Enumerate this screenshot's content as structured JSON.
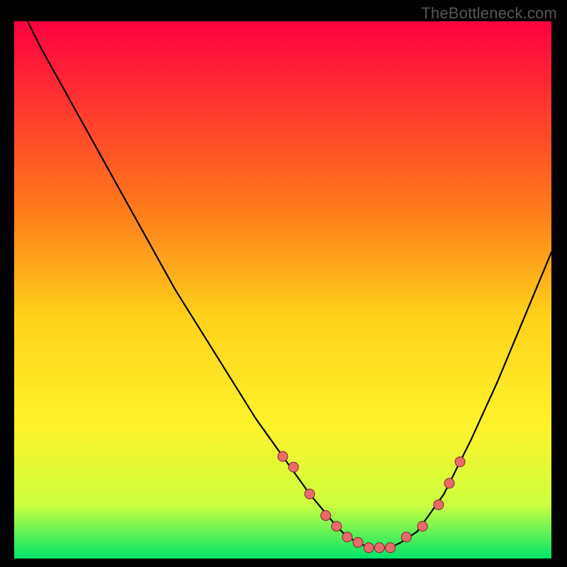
{
  "watermark": "TheBottleneck.com",
  "colors": {
    "gradient": [
      "#ff0040",
      "#ff7a1a",
      "#ffd21a",
      "#fff22a",
      "#ccff3e",
      "#00e56a"
    ],
    "curve_stroke": "#000000",
    "dot_fill": "#ea6a6a",
    "dot_stroke": "#7a2430"
  },
  "chart_data": {
    "type": "line",
    "title": "",
    "xlabel": "",
    "ylabel": "",
    "xlim": [
      0,
      100
    ],
    "ylim": [
      0,
      100
    ],
    "grid": false,
    "legend": false,
    "series": [
      {
        "name": "bottleneck-curve",
        "x": [
          0,
          5,
          10,
          15,
          20,
          25,
          30,
          35,
          40,
          45,
          50,
          55,
          60,
          62,
          64,
          66,
          68,
          70,
          72,
          75,
          80,
          85,
          90,
          95,
          100
        ],
        "values": [
          105,
          95,
          86,
          77,
          68,
          59,
          50,
          42,
          34,
          26,
          19,
          12,
          6,
          4,
          3,
          2,
          2,
          2,
          3,
          5,
          12,
          22,
          33,
          45,
          57
        ]
      }
    ],
    "annotations": {
      "salmon_dots": {
        "x": [
          50,
          52,
          55,
          58,
          60,
          62,
          64,
          66,
          68,
          70,
          73,
          76,
          79,
          81,
          83
        ],
        "values": [
          19,
          17,
          12,
          8,
          6,
          4,
          3,
          2,
          2,
          2,
          4,
          6,
          10,
          14,
          18
        ]
      }
    }
  }
}
